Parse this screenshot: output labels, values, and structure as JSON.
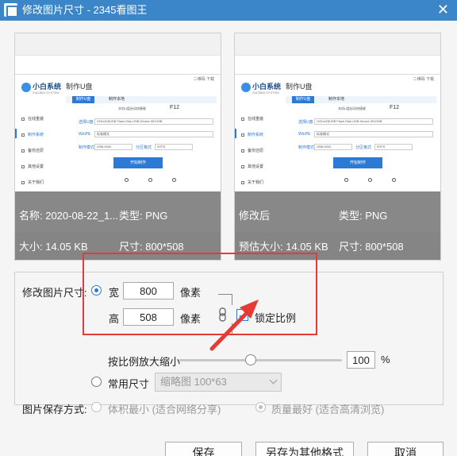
{
  "window": {
    "title": "修改图片尺寸 - 2345看图王"
  },
  "preview_original": {
    "name_label": "名称: 2020-08-22_1...",
    "type_label": "类型: PNG",
    "size_label": "大小: 14.05 KB",
    "dims_label": "尺寸: 800*508"
  },
  "preview_modified": {
    "title_label": "修改后",
    "type_label": "类型: PNG",
    "est_size_label": "预估大小: 14.05 KB",
    "dims_label": "尺寸: 800*508"
  },
  "mini_screenshot": {
    "brand": "小白系统",
    "tagline": "XIAOBAI SYSTEM",
    "app_title": "制作U盘",
    "top_right": "二维码 下载",
    "tab_active": "制作U盘",
    "tab_other": "制作本地",
    "sidebar": [
      "在线重装",
      "制作系统",
      "备份还原",
      "其他设置",
      "关于我们"
    ],
    "info": "本机U盘启动快捷键",
    "hotkey": "F12",
    "lbl_usb": "选择U盘",
    "usb_value": "GOIx425USB Flash Disk USB Device 3010GB",
    "lbl_mode": "WinPE",
    "mode_value": "标准模式",
    "lbl_format": "制作模式",
    "format_value": "USB-HDD",
    "lbl_part": "分区格式",
    "part_value": "NTFS",
    "start_button": "开始制作"
  },
  "resize": {
    "section_label": "修改图片尺寸:",
    "width_label": "宽",
    "width_value": "800",
    "width_unit": "像素",
    "height_label": "高",
    "height_value": "508",
    "height_unit": "像素",
    "lock_label": "锁定比例",
    "lock_checked": true,
    "scale_label": "按比例放大缩小",
    "scale_percent": 100,
    "scale_value": "100",
    "scale_unit": "%",
    "common_size_label": "常用尺寸",
    "common_size_value": "缩略图 100*63"
  },
  "save_mode": {
    "label": "图片保存方式:",
    "option_small": "体积最小 (适合网络分享)",
    "option_quality": "质量最好 (适合高清浏览)"
  },
  "buttons": {
    "save": "保存",
    "save_as": "另存为其他格式",
    "cancel": "取消"
  },
  "colors": {
    "titlebar": "#3a86c8",
    "accent": "#2d7ad6",
    "annotation_red": "#e53b34"
  }
}
